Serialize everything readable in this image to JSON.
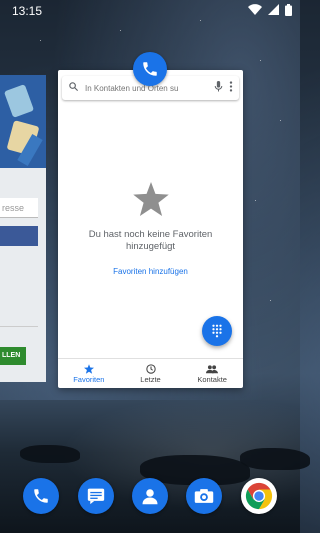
{
  "status_bar": {
    "time": "13:15",
    "icons": [
      "wifi-icon",
      "signal-icon",
      "battery-icon"
    ]
  },
  "left_card": {
    "field_placeholder": "resse",
    "button_label": "LLEN"
  },
  "phone_app": {
    "icon": "phone-icon",
    "search": {
      "placeholder": "In Kontakten und Orten su",
      "icons": [
        "search-icon",
        "mic-icon",
        "more-vert-icon"
      ]
    },
    "empty_state": {
      "icon": "star-icon",
      "message_line1": "Du hast noch keine Favoriten",
      "message_line2": "hinzugefügt",
      "link": "Favoriten hinzufügen"
    },
    "fab_icon": "dialpad-icon",
    "nav": [
      {
        "label": "Favoriten",
        "icon": "star-icon",
        "active": true
      },
      {
        "label": "Letzte",
        "icon": "clock-icon",
        "active": false
      },
      {
        "label": "Kontakte",
        "icon": "people-icon",
        "active": false
      }
    ]
  },
  "dock": [
    {
      "name": "Phone",
      "icon": "phone-icon",
      "color": "#1a73e8"
    },
    {
      "name": "Messages",
      "icon": "message-icon",
      "color": "#1a73e8"
    },
    {
      "name": "Contacts",
      "icon": "person-icon",
      "color": "#1a73e8"
    },
    {
      "name": "Camera",
      "icon": "camera-icon",
      "color": "#1a73e8"
    },
    {
      "name": "Chrome",
      "icon": "chrome-icon",
      "color": "#fff"
    }
  ],
  "colors": {
    "accent": "#1a73e8",
    "left_button": "#2e8b2e"
  }
}
